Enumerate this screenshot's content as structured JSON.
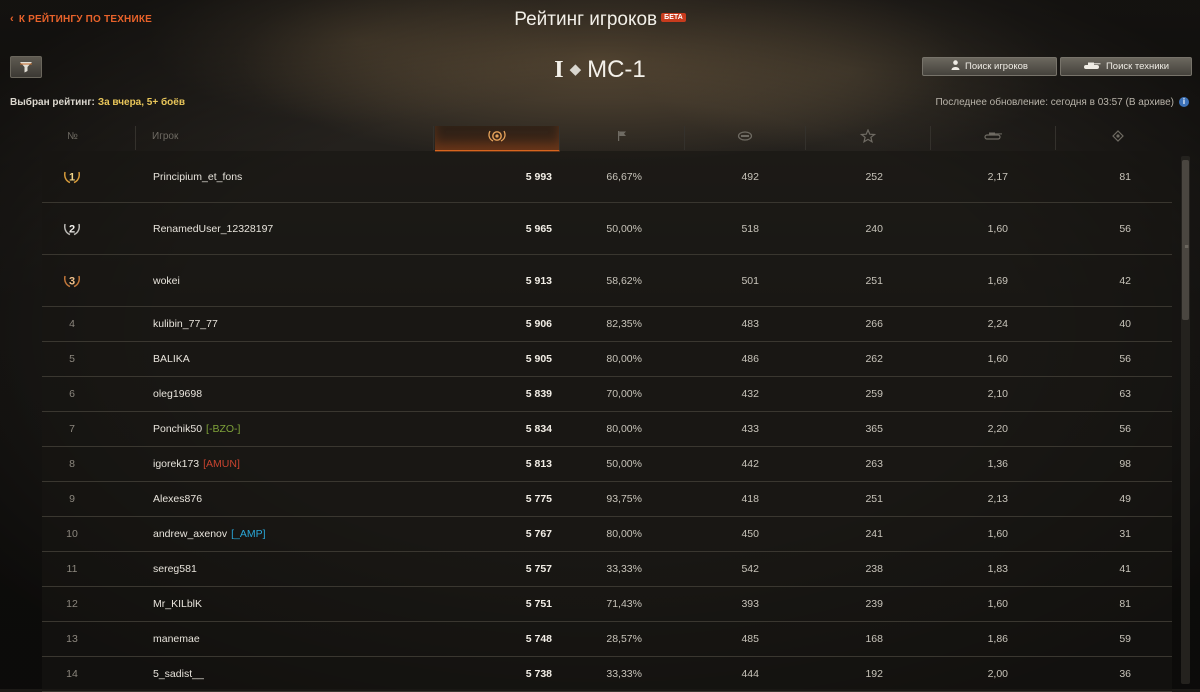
{
  "header": {
    "back_label": "К РЕЙТИНГУ ПО ТЕХНИКЕ",
    "title": "Рейтинг игроков",
    "beta": "БЕТА",
    "tier": "I",
    "vehicle": "МС-1",
    "selected_label": "Выбран рейтинг:",
    "selected_value": "За вчера, 5+ боёв",
    "search_players": "Поиск игроков",
    "search_tech": "Поиск техники",
    "update_text": "Последнее обновление: сегодня в 03:57 (В архиве)"
  },
  "icons": {
    "back": "chevron-left-icon",
    "filter": "funnel-icon",
    "player": "person-icon",
    "tank": "tank-icon",
    "info": "info-icon",
    "rating": "laurel-icon",
    "wins": "flag-icon",
    "damage": "damage-icon",
    "xp": "star-icon",
    "frags": "tank-kill-icon",
    "spotting": "spotting-icon"
  },
  "columns": {
    "rank": "№",
    "player": "Игрок"
  },
  "colors": {
    "accent": "#e8622a",
    "selected_value": "#e9c65a",
    "clan_bzo": "#7fa33a",
    "clan_amun": "#c8432f",
    "clan_amp": "#2aa7d8"
  },
  "rows": [
    {
      "rank": "1",
      "name": "Principium_et_fons",
      "clan": "",
      "rating": "5 993",
      "win": "66,67%",
      "dmg": "492",
      "xp": "252",
      "frag": "2,17",
      "spot": "81"
    },
    {
      "rank": "2",
      "name": "RenamedUser_12328197",
      "clan": "",
      "rating": "5 965",
      "win": "50,00%",
      "dmg": "518",
      "xp": "240",
      "frag": "1,60",
      "spot": "56"
    },
    {
      "rank": "3",
      "name": "wokei",
      "clan": "",
      "rating": "5 913",
      "win": "58,62%",
      "dmg": "501",
      "xp": "251",
      "frag": "1,69",
      "spot": "42"
    },
    {
      "rank": "4",
      "name": "kulibin_77_77",
      "clan": "",
      "rating": "5 906",
      "win": "82,35%",
      "dmg": "483",
      "xp": "266",
      "frag": "2,24",
      "spot": "40"
    },
    {
      "rank": "5",
      "name": "BALIKA",
      "clan": "",
      "rating": "5 905",
      "win": "80,00%",
      "dmg": "486",
      "xp": "262",
      "frag": "1,60",
      "spot": "56"
    },
    {
      "rank": "6",
      "name": "oleg19698",
      "clan": "",
      "rating": "5 839",
      "win": "70,00%",
      "dmg": "432",
      "xp": "259",
      "frag": "2,10",
      "spot": "63"
    },
    {
      "rank": "7",
      "name": "Ponchik50",
      "clan": "[-BZO-]",
      "clan_color": "#7fa33a",
      "rating": "5 834",
      "win": "80,00%",
      "dmg": "433",
      "xp": "365",
      "frag": "2,20",
      "spot": "56"
    },
    {
      "rank": "8",
      "name": "igorek173",
      "clan": "[AMUN]",
      "clan_color": "#c8432f",
      "rating": "5 813",
      "win": "50,00%",
      "dmg": "442",
      "xp": "263",
      "frag": "1,36",
      "spot": "98"
    },
    {
      "rank": "9",
      "name": "Alexes876",
      "clan": "",
      "rating": "5 775",
      "win": "93,75%",
      "dmg": "418",
      "xp": "251",
      "frag": "2,13",
      "spot": "49"
    },
    {
      "rank": "10",
      "name": "andrew_axenov",
      "clan": "[_AMP]",
      "clan_color": "#2aa7d8",
      "rating": "5 767",
      "win": "80,00%",
      "dmg": "450",
      "xp": "241",
      "frag": "1,60",
      "spot": "31"
    },
    {
      "rank": "11",
      "name": "sereg581",
      "clan": "",
      "rating": "5 757",
      "win": "33,33%",
      "dmg": "542",
      "xp": "238",
      "frag": "1,83",
      "spot": "41"
    },
    {
      "rank": "12",
      "name": "Mr_KILblK",
      "clan": "",
      "rating": "5 751",
      "win": "71,43%",
      "dmg": "393",
      "xp": "239",
      "frag": "1,60",
      "spot": "81"
    },
    {
      "rank": "13",
      "name": "manemae",
      "clan": "",
      "rating": "5 748",
      "win": "28,57%",
      "dmg": "485",
      "xp": "168",
      "frag": "1,86",
      "spot": "59"
    },
    {
      "rank": "14",
      "name": "5_sadist__",
      "clan": "",
      "rating": "5 738",
      "win": "33,33%",
      "dmg": "444",
      "xp": "192",
      "frag": "2,00",
      "spot": "36"
    }
  ]
}
